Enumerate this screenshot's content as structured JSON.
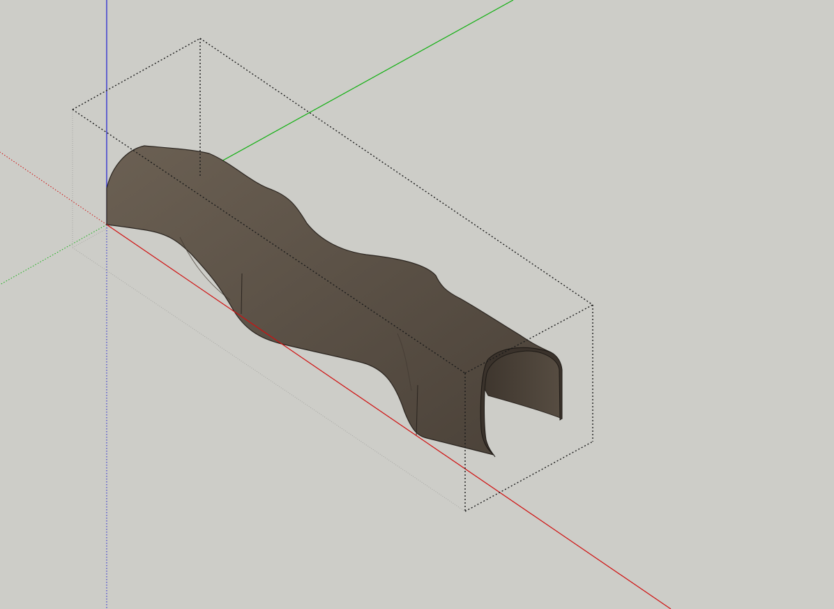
{
  "viewport": {
    "background_color": "#cdcdc8",
    "axis_colors": {
      "x_red": "#d01010",
      "y_green": "#10b010",
      "z_blue": "#1a1ad0"
    },
    "model": {
      "description": "wavy-shelled-tunnel-component",
      "fill_color": "#5a5046",
      "edge_color": "#2a241f",
      "selection_box_color": "#1a1a1a"
    }
  }
}
